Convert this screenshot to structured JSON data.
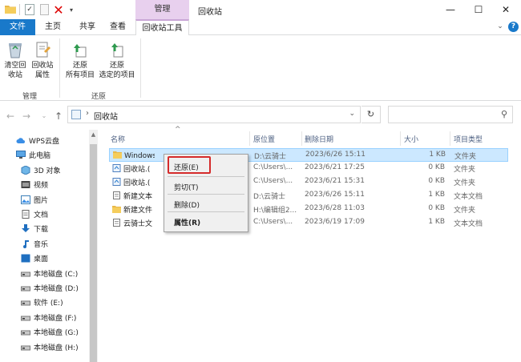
{
  "window": {
    "title": "回收站",
    "context_tab_group": "管理",
    "controls": {
      "minimize": "—",
      "maximize": "☐",
      "close": "✕"
    }
  },
  "ribbon_tabs": [
    "文件",
    "主页",
    "共享",
    "查看",
    "回收站工具"
  ],
  "ribbon": {
    "manage": {
      "label": "管理",
      "empty_bin": [
        "清空回",
        "收站"
      ],
      "properties": [
        "回收站",
        "属性"
      ]
    },
    "restore": {
      "label": "还原",
      "restore_all": [
        "还原",
        "所有项目"
      ],
      "restore_selected": [
        "还原",
        "选定的项目"
      ]
    }
  },
  "address": {
    "path": "回收站"
  },
  "nav_pane": [
    {
      "label": "WPS云盘",
      "icon": "cloud-icon",
      "indent": 20
    },
    {
      "label": "此电脑",
      "icon": "computer-icon",
      "indent": 20
    },
    {
      "label": "3D 对象",
      "icon": "cube-icon",
      "indent": 26
    },
    {
      "label": "视频",
      "icon": "video-icon",
      "indent": 26
    },
    {
      "label": "图片",
      "icon": "picture-icon",
      "indent": 26
    },
    {
      "label": "文档",
      "icon": "document-icon",
      "indent": 26
    },
    {
      "label": "下载",
      "icon": "download-icon",
      "indent": 26
    },
    {
      "label": "音乐",
      "icon": "music-icon",
      "indent": 26
    },
    {
      "label": "桌面",
      "icon": "desktop-icon",
      "indent": 26
    },
    {
      "label": "本地磁盘 (C:)",
      "icon": "drive-icon",
      "indent": 26
    },
    {
      "label": "本地磁盘 (D:)",
      "icon": "drive-icon",
      "indent": 26
    },
    {
      "label": "软件 (E:)",
      "icon": "drive-icon",
      "indent": 26
    },
    {
      "label": "本地磁盘 (F:)",
      "icon": "drive-icon",
      "indent": 26
    },
    {
      "label": "本地磁盘 (G:)",
      "icon": "drive-icon",
      "indent": 26
    },
    {
      "label": "本地磁盘 (H:)",
      "icon": "drive-icon",
      "indent": 26
    }
  ],
  "columns": {
    "name": "名称",
    "location": "原位置",
    "deleted": "删除日期",
    "size": "大小",
    "type": "项目类型"
  },
  "files": [
    {
      "name": "Windows",
      "icon": "folder-icon",
      "location": "D:\\云骑士",
      "deleted": "2023/6/26 15:11",
      "size": "1 KB",
      "type": "文件夹",
      "selected": true
    },
    {
      "name": "回收站.(",
      "icon": "recycle-file-icon",
      "location": "C:\\Users\\...",
      "deleted": "2023/6/21 17:25",
      "size": "0 KB",
      "type": "文件夹",
      "selected": false
    },
    {
      "name": "回收站.(",
      "icon": "recycle-file-icon",
      "location": "C:\\Users\\...",
      "deleted": "2023/6/21 15:31",
      "size": "0 KB",
      "type": "文件夹",
      "selected": false
    },
    {
      "name": "新建文本",
      "icon": "text-file-icon",
      "location": "D:\\云骑士",
      "deleted": "2023/6/26 15:11",
      "size": "1 KB",
      "type": "文本文档",
      "selected": false
    },
    {
      "name": "新建文件",
      "icon": "folder-icon",
      "location": "H:\\编辑组2...",
      "deleted": "2023/6/28 11:03",
      "size": "0 KB",
      "type": "文件夹",
      "selected": false
    },
    {
      "name": "云骑士文",
      "icon": "text-file-icon",
      "location": "C:\\Users\\...",
      "deleted": "2023/6/19 17:09",
      "size": "1 KB",
      "type": "文本文档",
      "selected": false
    }
  ],
  "context_menu": {
    "restore": "还原(E)",
    "cut": "剪切(T)",
    "delete": "删除(D)",
    "properties": "属性(R)"
  },
  "colors": {
    "accent": "#1979ca",
    "context_tab": "#e8d0ee",
    "selection": "#cce8ff",
    "highlight_box": "#d52b2b"
  }
}
